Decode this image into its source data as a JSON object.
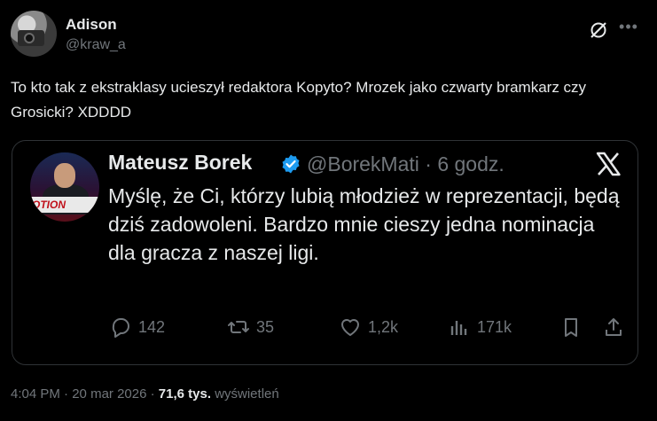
{
  "author": {
    "name": "Adison",
    "handle": "@kraw_a"
  },
  "tweet": {
    "text": "To kto tak z ekstraklasy ucieszył redaktora Kopyto? Mrozek jako czwarty bramkarz czy Grosicki? XDDDD"
  },
  "quoted": {
    "name": "Mateusz Borek",
    "handle_time": "@BorekMati · 6 godz.",
    "avatar_banner": "OTION",
    "text": "Myślę, że Ci, którzy lubią młodzież w reprezentacji, będą dziś zadowoleni. Bardzo mnie cieszy jedna nominacja dla gracza z naszej ligi.",
    "actions": {
      "replies": "142",
      "reposts": "35",
      "likes": "1,2k",
      "views": "171k"
    }
  },
  "meta": {
    "time": "4:04 PM",
    "sep1": "·",
    "date": "20 mar 2026",
    "sep2": "·",
    "views_count": "71,6 tys.",
    "views_label": "wyświetleń"
  },
  "colors": {
    "background": "#000000",
    "text": "#e7e9ea",
    "muted": "#71767b",
    "verified": "#1d9bf0",
    "border": "#2f3336"
  },
  "icons": [
    "grok-icon",
    "more-icon",
    "verified-icon",
    "x-logo-icon",
    "reply-icon",
    "repost-icon",
    "like-icon",
    "views-icon",
    "bookmark-icon",
    "share-icon"
  ]
}
